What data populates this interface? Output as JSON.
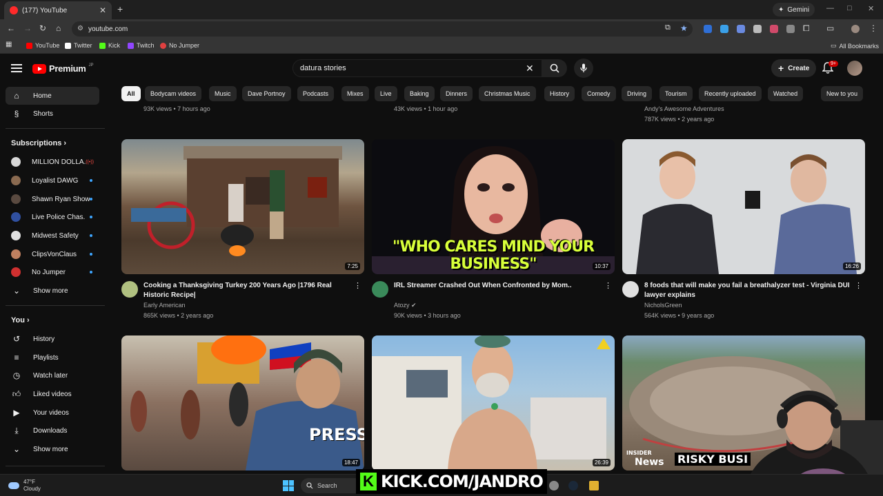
{
  "browser": {
    "tab_title": "(177) YouTube",
    "gemini_label": "Gemini",
    "url": "youtube.com",
    "bookmarks": [
      {
        "label": "YouTube",
        "color": "#ff0000"
      },
      {
        "label": "Twitter",
        "color": "#ffffff"
      },
      {
        "label": "Kick",
        "color": "#53fc18"
      },
      {
        "label": "Twitch",
        "color": "#9146ff"
      },
      {
        "label": "No Jumper",
        "color": "#e04040"
      }
    ],
    "all_bookmarks": "All Bookmarks"
  },
  "header": {
    "logo_text": "Premium",
    "logo_region": "JP",
    "search_value": "datura stories",
    "create_label": "Create",
    "notif_badge": "9+"
  },
  "sidebar": {
    "home": "Home",
    "shorts": "Shorts",
    "subscriptions_heading": "Subscriptions",
    "subscriptions": [
      {
        "label": "MILLION DOLLA...",
        "color": "#d8d8d8",
        "indicator": "live"
      },
      {
        "label": "Loyalist DAWG",
        "color": "#8a6a50",
        "indicator": "dot"
      },
      {
        "label": "Shawn Ryan Show",
        "color": "#5a4a40",
        "indicator": "dot"
      },
      {
        "label": "Live Police Chas...",
        "color": "#3050a0",
        "indicator": "dot"
      },
      {
        "label": "Midwest Safety",
        "color": "#e0e0e0",
        "indicator": "dot"
      },
      {
        "label": "ClipsVonClaus",
        "color": "#c08060",
        "indicator": "dot"
      },
      {
        "label": "No Jumper",
        "color": "#d03030",
        "indicator": "dot"
      }
    ],
    "show_more_1": "Show more",
    "you_heading": "You",
    "you_items": [
      {
        "label": "History",
        "icon": "history-icon"
      },
      {
        "label": "Playlists",
        "icon": "playlists-icon"
      },
      {
        "label": "Watch later",
        "icon": "watch-later-icon"
      },
      {
        "label": "Liked videos",
        "icon": "thumbs-up-icon"
      },
      {
        "label": "Your videos",
        "icon": "your-videos-icon"
      },
      {
        "label": "Downloads",
        "icon": "download-icon"
      }
    ],
    "show_more_2": "Show more"
  },
  "chips": [
    "All",
    "Bodycam videos",
    "Music",
    "Dave Portnoy",
    "Podcasts",
    "Mixes",
    "Live",
    "Baking",
    "Dinners",
    "Christmas Music",
    "History",
    "Comedy",
    "Driving",
    "Tourism",
    "Recently uploaded",
    "Watched",
    "New to you"
  ],
  "top_row_partial": [
    {
      "stats": "93K views • 7 hours ago"
    },
    {
      "stats": "43K views • 1 hour ago"
    },
    {
      "channel": "Andy's Awesome Adventures",
      "stats": "787K views • 2 years ago"
    }
  ],
  "videos": [
    {
      "title": "Cooking a Thanksgiving Turkey 200 Years Ago |1796 Real Historic Recipe|",
      "channel": "Early American",
      "stats": "865K views • 2 years ago",
      "duration": "7:25"
    },
    {
      "title": "IRL Streamer Crashed Out When Confronted by Mom..",
      "channel": "Atozy",
      "stats": "90K views • 3 hours ago",
      "duration": "10:37",
      "thumb_caption": "\"WHO CARES MIND YOUR BUSINESS\""
    },
    {
      "title": "8 foods that will make you fail a breathalyzer test - Virginia DUI lawyer explains",
      "channel": "NicholsGreen",
      "stats": "564K views • 9 years ago",
      "duration": "16:26"
    },
    {
      "duration": "18:47",
      "thumb_caption": "PRESS"
    },
    {
      "duration": "26:39"
    },
    {
      "thumb_caption": "RISKY BUSI",
      "thumb_brand": "INSIDER",
      "thumb_brand2": "News"
    }
  ],
  "taskbar": {
    "temp": "47°F",
    "condition": "Cloudy",
    "search_label": "Search"
  },
  "overlay": {
    "kick_text": "KICK.COM/JANDRO"
  }
}
